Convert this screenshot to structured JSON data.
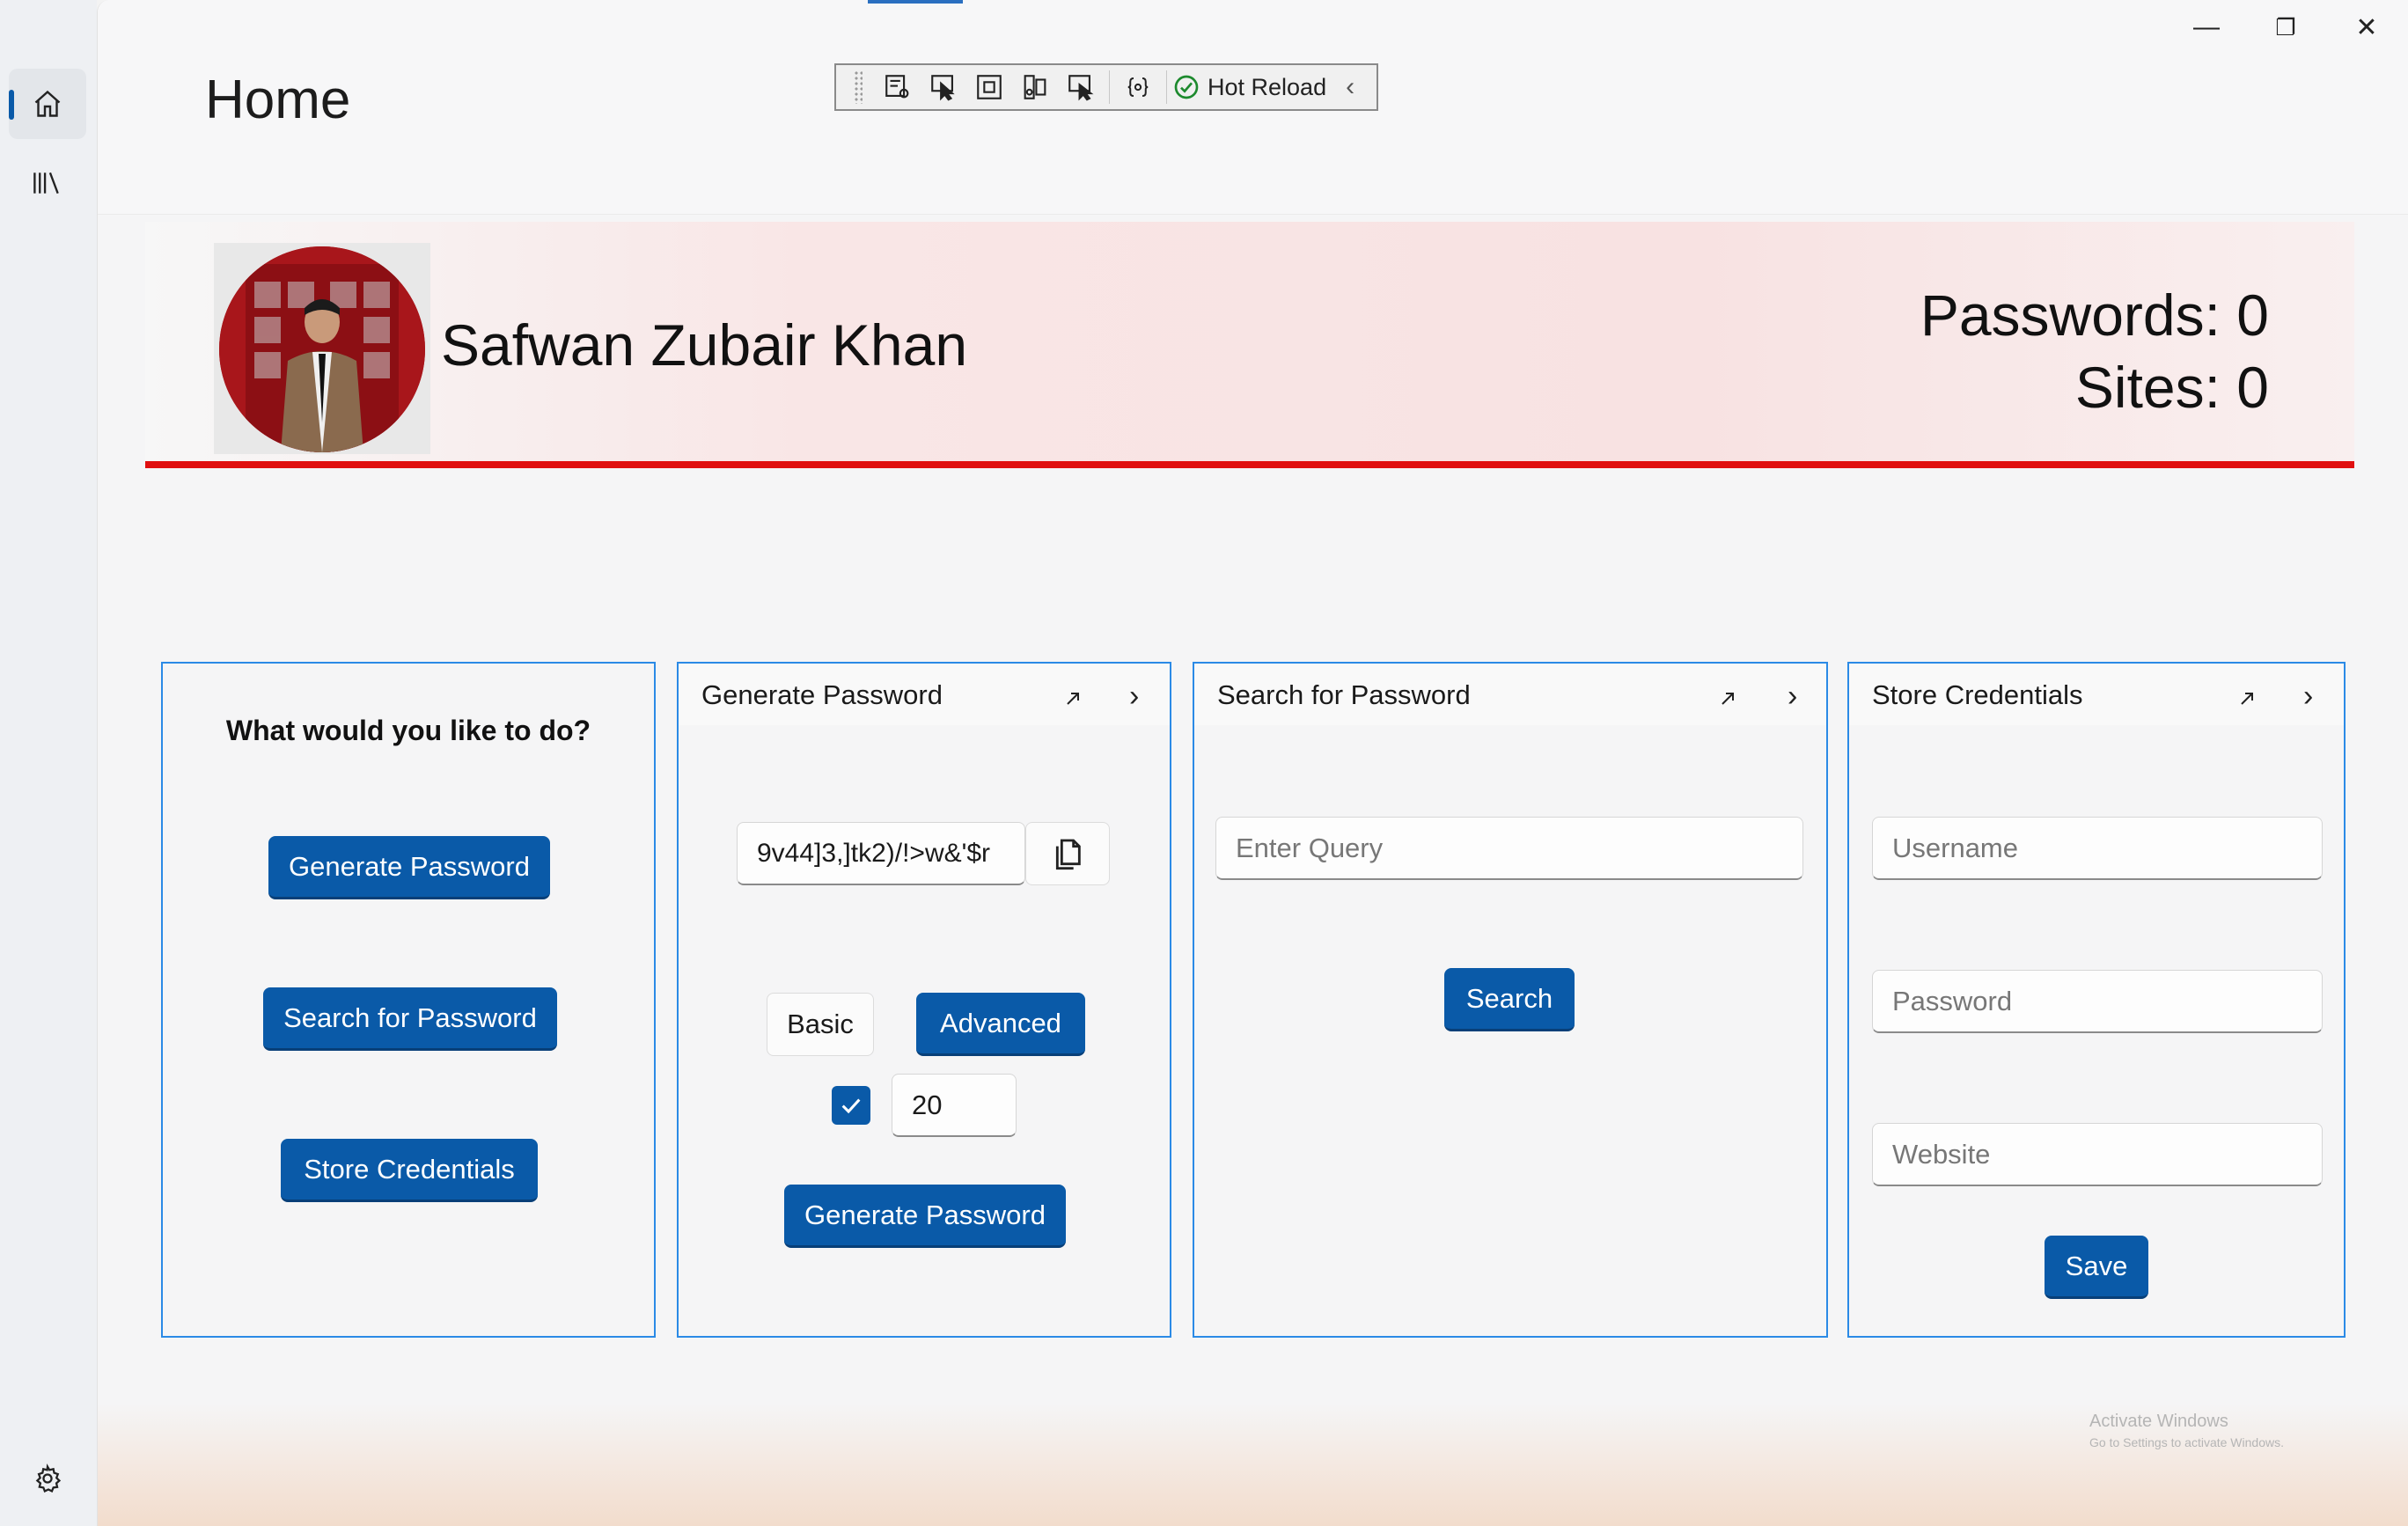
{
  "window": {
    "minimize_glyph": "—",
    "restore_glyph": "❐",
    "close_glyph": "✕"
  },
  "nav": {
    "items": [
      {
        "name": "home-icon",
        "active": true
      },
      {
        "name": "library-icon",
        "active": false
      }
    ],
    "settings_icon": "gear-icon"
  },
  "header": {
    "title": "Home"
  },
  "devbar": {
    "hot_reload_label": "Hot Reload",
    "collapse_glyph": "‹"
  },
  "profile": {
    "name": "Safwan Zubair Khan",
    "passwords_stat": "Passwords: 0",
    "sites_stat": "Sites: 0"
  },
  "menu_card": {
    "question": "What would you like to do?",
    "generate_label": "Generate Password",
    "search_label": "Search for Password",
    "store_label": "Store Credentials"
  },
  "generate_card": {
    "title": "Generate Password",
    "generated_value": "9v44]3,]tk2)/!>w&'$r",
    "basic_label": "Basic",
    "advanced_label": "Advanced",
    "length_value": "20",
    "checkbox_checked": true,
    "generate_label": "Generate Password"
  },
  "search_card": {
    "title": "Search for Password",
    "query_placeholder": "Enter Query",
    "search_label": "Search"
  },
  "store_card": {
    "title": "Store Credentials",
    "username_placeholder": "Username",
    "password_placeholder": "Password",
    "website_placeholder": "Website",
    "save_label": "Save"
  },
  "watermark": {
    "line1": "Activate Windows",
    "line2": "Go to Settings to activate Windows."
  },
  "colors": {
    "accent": "#0a5aa8",
    "card_border": "#2b8ae6",
    "banner_line": "#e01010"
  }
}
